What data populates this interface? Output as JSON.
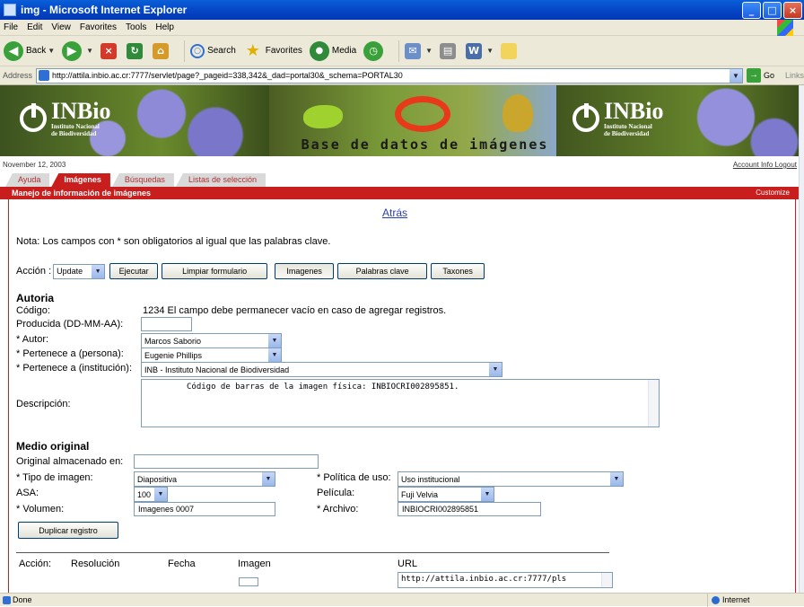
{
  "window": {
    "title": "img - Microsoft Internet Explorer"
  },
  "menu": [
    "File",
    "Edit",
    "View",
    "Favorites",
    "Tools",
    "Help"
  ],
  "toolbar": {
    "back": "Back",
    "search": "Search",
    "favorites": "Favorites",
    "media": "Media"
  },
  "address": {
    "label": "Address",
    "url": "http://attila.inbio.ac.cr:7777/servlet/page?_pageid=338,342&_dad=portal30&_schema=PORTAL30",
    "go": "Go",
    "links": "Links"
  },
  "banner": {
    "logo_word": "INBio",
    "logo_sub1": "Instituto Nacional",
    "logo_sub2": "de Biodiversidad",
    "caption": "Base de datos de imágenes"
  },
  "date": "November 12, 2003",
  "account": "Account Info Logout",
  "tabs": [
    "Ayuda",
    "Imágenes",
    "Búsquedas",
    "Listas de selección"
  ],
  "section": {
    "title": "Manejo de información de imágenes",
    "customize": "Customize"
  },
  "back_link": "Atrás",
  "note": "Nota: Los campos con * son obligatorios al igual que las palabras clave.",
  "action": {
    "label": "Acción :",
    "selected": "Update",
    "buttons": [
      "Ejecutar",
      "Limpiar formulario",
      "Imagenes",
      "Palabras clave",
      "Taxones"
    ]
  },
  "autoria": {
    "heading": "Autoria",
    "codigo_label": "Código:",
    "codigo_value": "1234 El campo debe permanecer vacío en caso de agregar registros.",
    "producida_label": "Producida (DD-MM-AA):",
    "producida_value": "",
    "autor_label": "* Autor:",
    "autor_value": "Marcos Saborio",
    "persona_label": "* Pertenece a (persona):",
    "persona_value": "Eugenie Phillips",
    "institucion_label": "* Pertenece a (institución):",
    "institucion_value": "INB - Instituto Nacional de Biodiversidad",
    "descripcion_label": "Descripción:",
    "descripcion_value": "Código de barras de la imagen física: INBIOCRI002895851."
  },
  "medio": {
    "heading": "Medio original",
    "almacenado_label": "Original almacenado en:",
    "almacenado_value": "",
    "tipo_label": "* Tipo de imagen:",
    "tipo_value": "Diapositiva",
    "politica_label": "* Política de uso:",
    "politica_value": "Uso institucional",
    "asa_label": "ASA:",
    "asa_value": "100",
    "pelicula_label": "Película:",
    "pelicula_value": "Fuji Velvia",
    "volumen_label": "* Volumen:",
    "volumen_value": "Imagenes 0007",
    "archivo_label": "* Archivo:",
    "archivo_value": "INBIOCRI002895851",
    "duplicar": "Duplicar registro"
  },
  "table": {
    "headers": [
      "Acción:",
      "Resolución",
      "Fecha",
      "Imagen",
      "URL"
    ],
    "url_value": "http://attila.inbio.ac.cr:7777/pls"
  },
  "status": {
    "left": "Done",
    "zone": "Internet"
  }
}
